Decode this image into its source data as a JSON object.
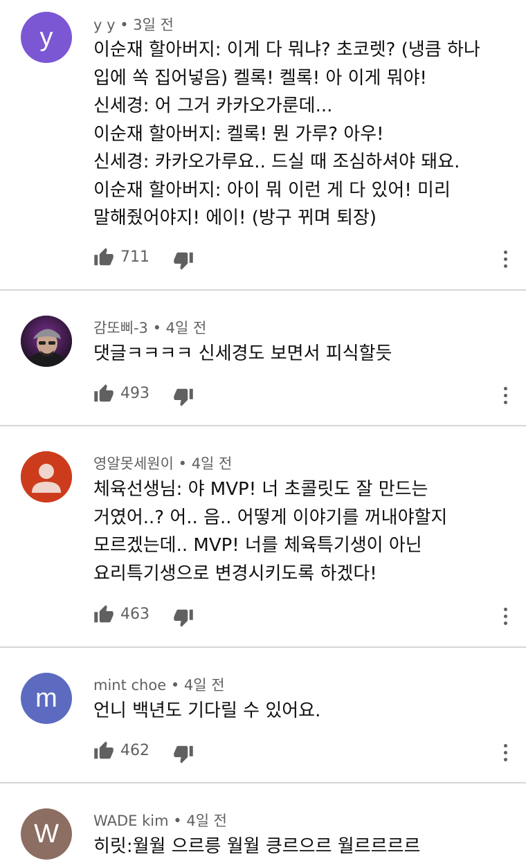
{
  "comments": [
    {
      "avatar_letter": "y",
      "avatar_color": "#7b57d4",
      "author": "y y",
      "time": "3일 전",
      "lines": [
        "이순재 할아버지: 이게 다 뭐냐? 초코렛? (냉큼 하나",
        "입에 쏙 집어넣음) 켈록! 켈록! 아 이게 뭐야!",
        "신세경: 어 그거 카카오가룬데...",
        "이순재 할아버지: 켈록! 뭔 가루? 아우!",
        "신세경: 카카오가루요.. 드실 때 조심하셔야 돼요.",
        "이순재 할아버지: 아이 뭐 이런 게 다 있어! 미리",
        "말해줬어야지! 에이! (방구 뀌며 퇴장)"
      ],
      "likes": "711"
    },
    {
      "avatar_letter": "",
      "avatar_color": "#2a1f2e",
      "author": "감또삐-3",
      "time": "4일 전",
      "lines": [
        "댓글ㅋㅋㅋㅋ 신세경도 보면서 피식할듯"
      ],
      "likes": "493"
    },
    {
      "avatar_letter": "",
      "avatar_color": "#cc3c1c",
      "author": "영알못세원이",
      "time": "4일 전",
      "lines": [
        "체육선생님: 야 MVP! 너 초콜릿도 잘 만드는",
        "거였어..? 어.. 음.. 어떻게 이야기를 꺼내야할지",
        "모르겠는데.. MVP! 너를 체육특기생이 아닌",
        "요리특기생으로 변경시키도록 하겠다!"
      ],
      "likes": "463"
    },
    {
      "avatar_letter": "m",
      "avatar_color": "#5c6bc0",
      "author": "mint choe",
      "time": "4일 전",
      "lines": [
        "언니 백년도 기다릴 수 있어요."
      ],
      "likes": "462"
    },
    {
      "avatar_letter": "W",
      "avatar_color": "#8d6e63",
      "author": "WADE kim",
      "time": "4일 전",
      "lines": [
        "히릿:월월 으르릉 월월 킁르으르 월르르르르"
      ],
      "likes": ""
    }
  ],
  "meta_separator": "•",
  "icons": {
    "like": "thumb-up-icon",
    "dislike": "thumb-down-icon",
    "more": "more-vertical-icon",
    "default_avatar": "person-silhouette-icon"
  }
}
